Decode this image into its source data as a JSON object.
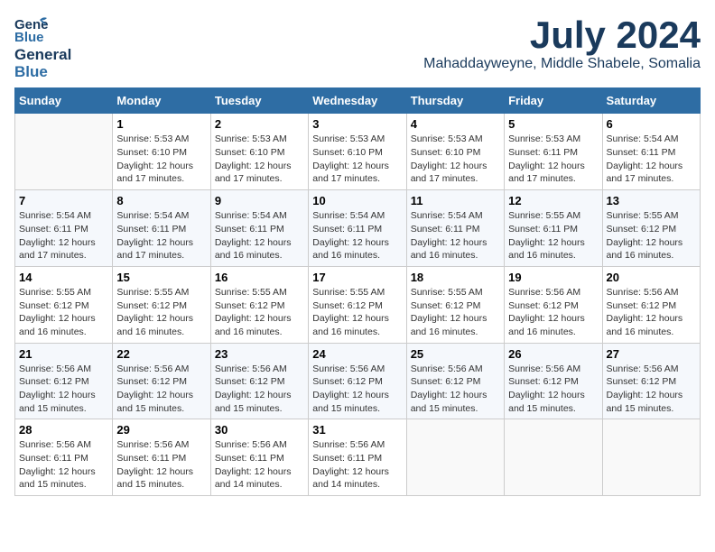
{
  "header": {
    "logo_line1": "General",
    "logo_line2": "Blue",
    "month_title": "July 2024",
    "subtitle": "Mahaddayweyne, Middle Shabele, Somalia"
  },
  "columns": [
    "Sunday",
    "Monday",
    "Tuesday",
    "Wednesday",
    "Thursday",
    "Friday",
    "Saturday"
  ],
  "weeks": [
    [
      {
        "day": "",
        "info": ""
      },
      {
        "day": "1",
        "info": "Sunrise: 5:53 AM\nSunset: 6:10 PM\nDaylight: 12 hours\nand 17 minutes."
      },
      {
        "day": "2",
        "info": "Sunrise: 5:53 AM\nSunset: 6:10 PM\nDaylight: 12 hours\nand 17 minutes."
      },
      {
        "day": "3",
        "info": "Sunrise: 5:53 AM\nSunset: 6:10 PM\nDaylight: 12 hours\nand 17 minutes."
      },
      {
        "day": "4",
        "info": "Sunrise: 5:53 AM\nSunset: 6:10 PM\nDaylight: 12 hours\nand 17 minutes."
      },
      {
        "day": "5",
        "info": "Sunrise: 5:53 AM\nSunset: 6:11 PM\nDaylight: 12 hours\nand 17 minutes."
      },
      {
        "day": "6",
        "info": "Sunrise: 5:54 AM\nSunset: 6:11 PM\nDaylight: 12 hours\nand 17 minutes."
      }
    ],
    [
      {
        "day": "7",
        "info": "Sunrise: 5:54 AM\nSunset: 6:11 PM\nDaylight: 12 hours\nand 17 minutes."
      },
      {
        "day": "8",
        "info": "Sunrise: 5:54 AM\nSunset: 6:11 PM\nDaylight: 12 hours\nand 17 minutes."
      },
      {
        "day": "9",
        "info": "Sunrise: 5:54 AM\nSunset: 6:11 PM\nDaylight: 12 hours\nand 16 minutes."
      },
      {
        "day": "10",
        "info": "Sunrise: 5:54 AM\nSunset: 6:11 PM\nDaylight: 12 hours\nand 16 minutes."
      },
      {
        "day": "11",
        "info": "Sunrise: 5:54 AM\nSunset: 6:11 PM\nDaylight: 12 hours\nand 16 minutes."
      },
      {
        "day": "12",
        "info": "Sunrise: 5:55 AM\nSunset: 6:11 PM\nDaylight: 12 hours\nand 16 minutes."
      },
      {
        "day": "13",
        "info": "Sunrise: 5:55 AM\nSunset: 6:12 PM\nDaylight: 12 hours\nand 16 minutes."
      }
    ],
    [
      {
        "day": "14",
        "info": "Sunrise: 5:55 AM\nSunset: 6:12 PM\nDaylight: 12 hours\nand 16 minutes."
      },
      {
        "day": "15",
        "info": "Sunrise: 5:55 AM\nSunset: 6:12 PM\nDaylight: 12 hours\nand 16 minutes."
      },
      {
        "day": "16",
        "info": "Sunrise: 5:55 AM\nSunset: 6:12 PM\nDaylight: 12 hours\nand 16 minutes."
      },
      {
        "day": "17",
        "info": "Sunrise: 5:55 AM\nSunset: 6:12 PM\nDaylight: 12 hours\nand 16 minutes."
      },
      {
        "day": "18",
        "info": "Sunrise: 5:55 AM\nSunset: 6:12 PM\nDaylight: 12 hours\nand 16 minutes."
      },
      {
        "day": "19",
        "info": "Sunrise: 5:56 AM\nSunset: 6:12 PM\nDaylight: 12 hours\nand 16 minutes."
      },
      {
        "day": "20",
        "info": "Sunrise: 5:56 AM\nSunset: 6:12 PM\nDaylight: 12 hours\nand 16 minutes."
      }
    ],
    [
      {
        "day": "21",
        "info": "Sunrise: 5:56 AM\nSunset: 6:12 PM\nDaylight: 12 hours\nand 15 minutes."
      },
      {
        "day": "22",
        "info": "Sunrise: 5:56 AM\nSunset: 6:12 PM\nDaylight: 12 hours\nand 15 minutes."
      },
      {
        "day": "23",
        "info": "Sunrise: 5:56 AM\nSunset: 6:12 PM\nDaylight: 12 hours\nand 15 minutes."
      },
      {
        "day": "24",
        "info": "Sunrise: 5:56 AM\nSunset: 6:12 PM\nDaylight: 12 hours\nand 15 minutes."
      },
      {
        "day": "25",
        "info": "Sunrise: 5:56 AM\nSunset: 6:12 PM\nDaylight: 12 hours\nand 15 minutes."
      },
      {
        "day": "26",
        "info": "Sunrise: 5:56 AM\nSunset: 6:12 PM\nDaylight: 12 hours\nand 15 minutes."
      },
      {
        "day": "27",
        "info": "Sunrise: 5:56 AM\nSunset: 6:12 PM\nDaylight: 12 hours\nand 15 minutes."
      }
    ],
    [
      {
        "day": "28",
        "info": "Sunrise: 5:56 AM\nSunset: 6:11 PM\nDaylight: 12 hours\nand 15 minutes."
      },
      {
        "day": "29",
        "info": "Sunrise: 5:56 AM\nSunset: 6:11 PM\nDaylight: 12 hours\nand 15 minutes."
      },
      {
        "day": "30",
        "info": "Sunrise: 5:56 AM\nSunset: 6:11 PM\nDaylight: 12 hours\nand 14 minutes."
      },
      {
        "day": "31",
        "info": "Sunrise: 5:56 AM\nSunset: 6:11 PM\nDaylight: 12 hours\nand 14 minutes."
      },
      {
        "day": "",
        "info": ""
      },
      {
        "day": "",
        "info": ""
      },
      {
        "day": "",
        "info": ""
      }
    ]
  ]
}
